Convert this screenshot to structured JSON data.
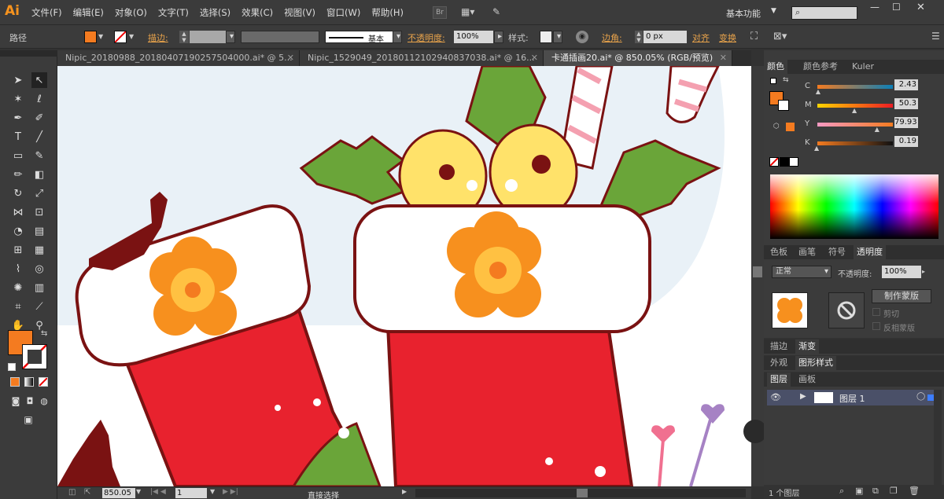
{
  "app": {
    "logo": "Ai"
  },
  "menu": [
    "文件(F)",
    "编辑(E)",
    "对象(O)",
    "文字(T)",
    "选择(S)",
    "效果(C)",
    "视图(V)",
    "窗口(W)",
    "帮助(H)"
  ],
  "top_right": {
    "br_label": "Br",
    "workspace": "基本功能",
    "search_placeholder": ""
  },
  "control": {
    "object_type": "路径",
    "stroke_label": "描边:",
    "stroke_style": "基本",
    "opacity_label": "不透明度:",
    "opacity_value": "100%",
    "style_label": "样式:",
    "corner_label": "边角:",
    "corner_value": "0 px",
    "align_label": "对齐",
    "transform_label": "变换",
    "fill_color": "#f47b20"
  },
  "tabs": [
    {
      "label": "Nipic_20180988_20180407190257504000.ai* @ 5...",
      "active": false
    },
    {
      "label": "Nipic_1529049_20180112102940837038.ai* @ 16...",
      "active": false
    },
    {
      "label": "卡通插画20.ai* @ 850.05% (RGB/预览)",
      "active": true
    }
  ],
  "status": {
    "zoom": "850.05",
    "page": "1",
    "tool_name": "直接选择"
  },
  "color_panel": {
    "tabs": [
      "颜色",
      "颜色参考",
      "Kuler"
    ],
    "sliders": [
      {
        "label": "C",
        "value": "2.43",
        "pos": 0.02
      },
      {
        "label": "M",
        "value": "50.3",
        "pos": 0.5
      },
      {
        "label": "Y",
        "value": "79.93",
        "pos": 0.8
      },
      {
        "label": "K",
        "value": "0.19",
        "pos": 0.0
      }
    ]
  },
  "swatches_tabs": [
    "色板",
    "画笔",
    "符号",
    "透明度"
  ],
  "transparency": {
    "mode": "正常",
    "opacity_label": "不透明度:",
    "opacity_value": "100%",
    "make_mask": "制作蒙版",
    "clip": "剪切",
    "invert": "反相蒙版"
  },
  "stroke_gradient_tabs": [
    "描边",
    "渐变"
  ],
  "appearance_tabs": [
    "外观",
    "图形样式"
  ],
  "layers_panel": {
    "tabs": [
      "图层",
      "画板"
    ],
    "layer_name": "图层 1",
    "count_label": "1 个图层"
  },
  "colors": {
    "accent": "#f47b20",
    "sock_red": "#e8222e",
    "cuff": "#ffffff",
    "outline": "#7a1212",
    "flower": "#f7901e",
    "leaf": "#6aa539",
    "bell": "#ffe26a"
  }
}
